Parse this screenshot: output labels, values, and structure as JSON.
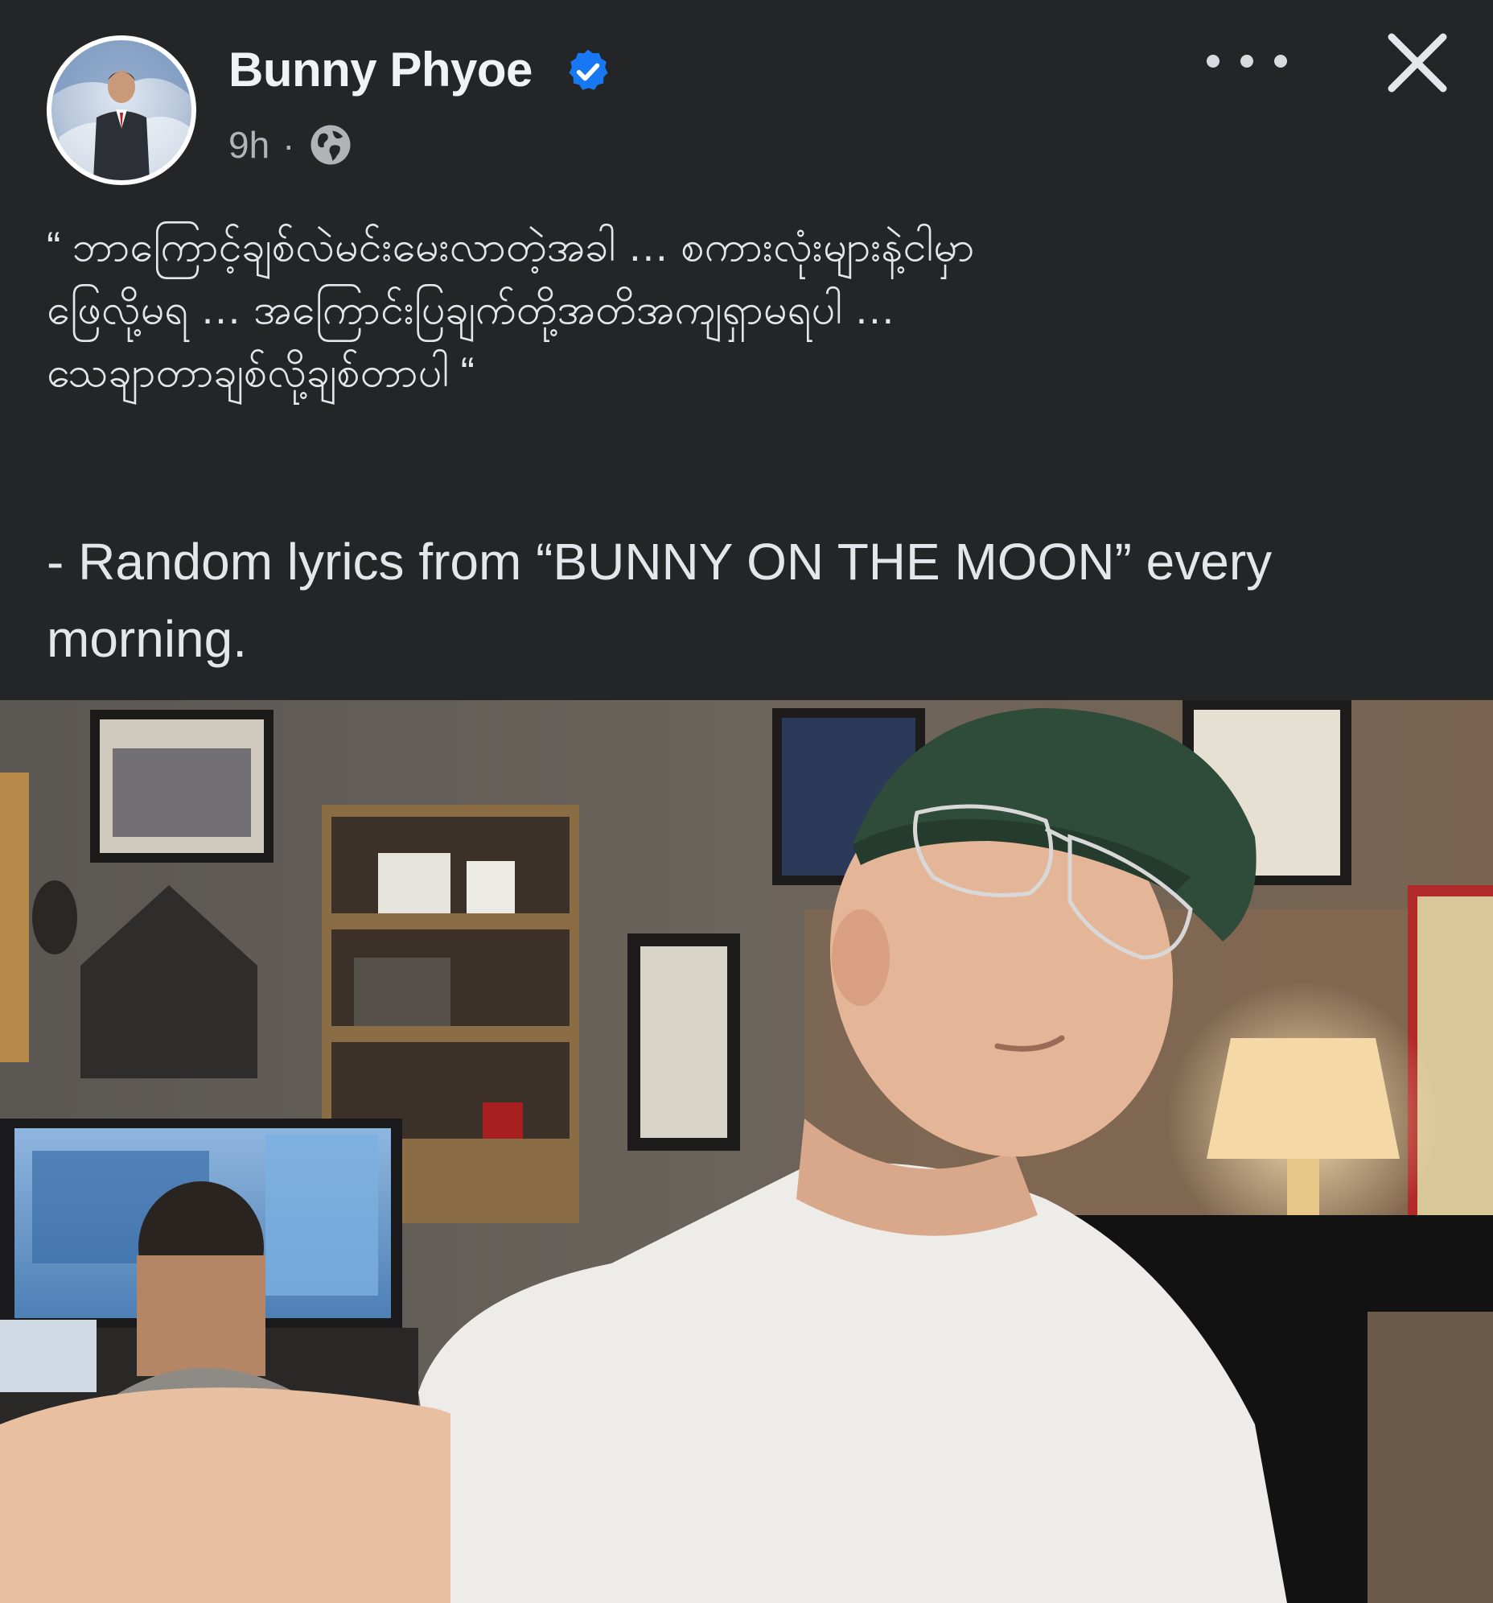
{
  "post": {
    "author": "Bunny Phyoe",
    "verified": true,
    "time": "9h",
    "separator": "·",
    "privacy_icon": "globe-icon",
    "caption_lines": [
      "“ ဘာကြောင့်ချစ်လဲမင်းမေးလာတဲ့အခါ … စကားလုံးများနဲ့ငါမှာ",
      "ဖြေလို့မရ … အကြောင်းပြချက်တို့အတိအကျရှာမရပါ …",
      "သေချာတာချစ်လို့ချစ်တာပါ “"
    ],
    "caption_en": "- Random lyrics from “BUNNY ON THE MOON” every morning."
  },
  "icons": {
    "more": "more-options-icon",
    "close": "close-icon",
    "verified": "verified-badge-icon"
  },
  "colors": {
    "background": "#242526",
    "text": "#e4e6eb",
    "muted": "#b0b3b8",
    "verified_blue": "#1877f2"
  }
}
